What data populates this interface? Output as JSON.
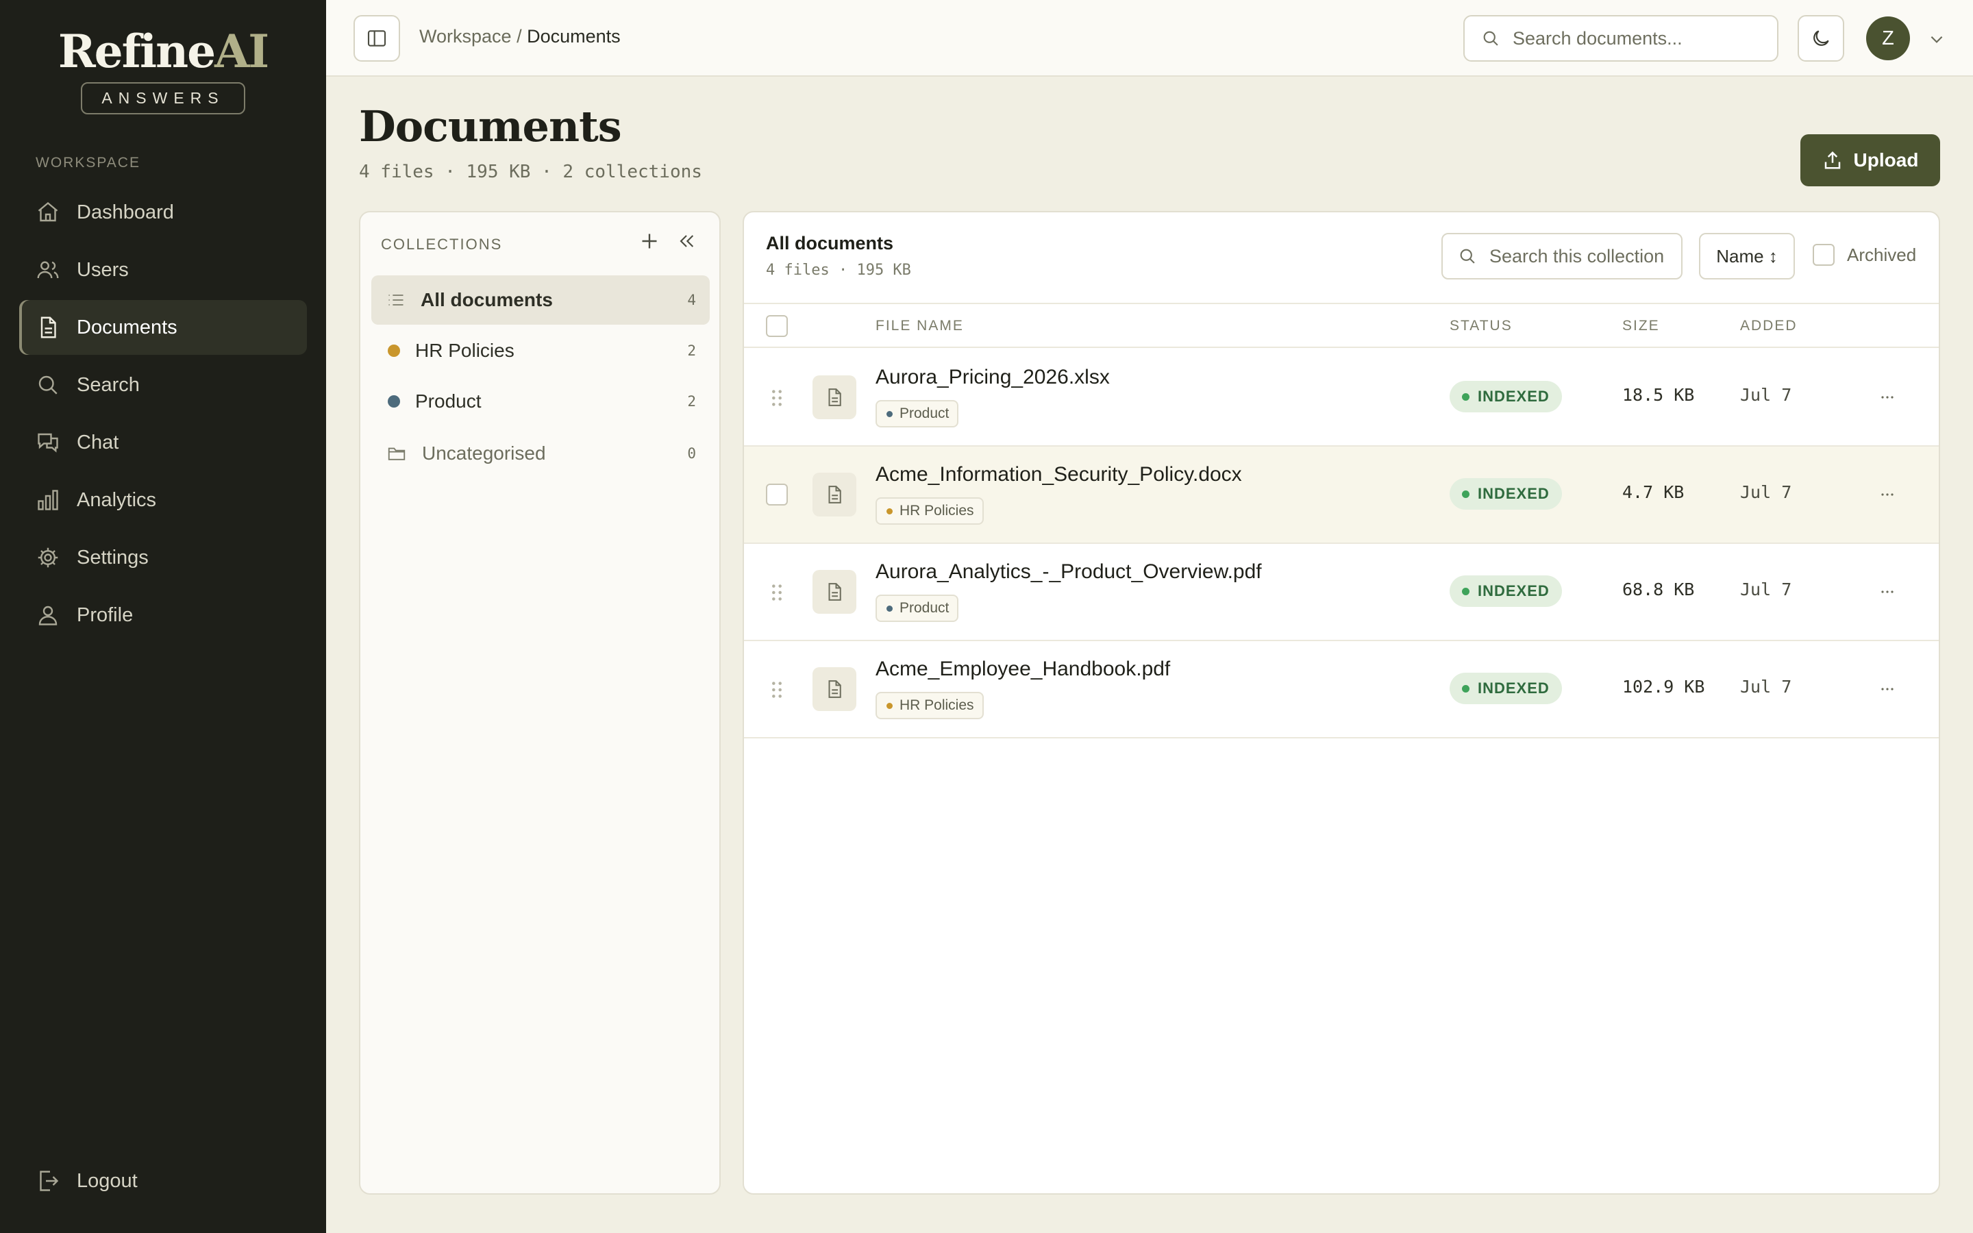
{
  "brand": {
    "name_main": "Refine",
    "name_accent": "AI",
    "tagline": "ANSWERS"
  },
  "sidebar": {
    "section_label": "WORKSPACE",
    "items": [
      {
        "label": "Dashboard",
        "icon": "home-icon"
      },
      {
        "label": "Users",
        "icon": "users-icon"
      },
      {
        "label": "Documents",
        "icon": "document-icon",
        "active": true
      },
      {
        "label": "Search",
        "icon": "search-icon"
      },
      {
        "label": "Chat",
        "icon": "chat-icon"
      },
      {
        "label": "Analytics",
        "icon": "bar-chart-icon"
      },
      {
        "label": "Settings",
        "icon": "gear-icon"
      },
      {
        "label": "Profile",
        "icon": "user-icon"
      }
    ],
    "logout_label": "Logout"
  },
  "topbar": {
    "breadcrumb_root": "Workspace",
    "breadcrumb_sep": "/",
    "breadcrumb_current": "Documents",
    "search_placeholder": "Search documents...",
    "avatar_initial": "Z"
  },
  "header": {
    "title": "Documents",
    "subtitle": "4 files · 195 KB · 2 collections",
    "upload_label": "Upload"
  },
  "collections": {
    "heading": "COLLECTIONS",
    "items": [
      {
        "label": "All documents",
        "count": "4"
      },
      {
        "label": "HR Policies",
        "count": "2",
        "color": "#c9962c"
      },
      {
        "label": "Product",
        "count": "2",
        "color": "#4d6b7c"
      },
      {
        "label": "Uncategorised",
        "count": "0"
      }
    ]
  },
  "main": {
    "title": "All documents",
    "subtitle": "4 files · 195 KB",
    "search_placeholder": "Search this collection",
    "sort_label": "Name ↕",
    "archived_label": "Archived",
    "columns": {
      "file_name": "FILE NAME",
      "status": "STATUS",
      "size": "SIZE",
      "added": "ADDED"
    },
    "rows": [
      {
        "name": "Aurora_Pricing_2026.xlsx",
        "tag": "Product",
        "status": "INDEXED",
        "size": "18.5 KB",
        "added": "Jul 7"
      },
      {
        "name": "Acme_Information_Security_Policy.docx",
        "tag": "HR Policies",
        "status": "INDEXED",
        "size": "4.7 KB",
        "added": "Jul 7"
      },
      {
        "name": "Aurora_Analytics_-_Product_Overview.pdf",
        "tag": "Product",
        "status": "INDEXED",
        "size": "68.8 KB",
        "added": "Jul 7"
      },
      {
        "name": "Acme_Employee_Handbook.pdf",
        "tag": "HR Policies",
        "status": "INDEXED",
        "size": "102.9 KB",
        "added": "Jul 7"
      }
    ]
  },
  "colors": {
    "sidebar_bg": "#1e1f19",
    "accent": "#4b5330",
    "page_bg": "#f1efe3",
    "status_green": "#3ea35a",
    "hr_tag": "#c9962c",
    "product_tag": "#4d6b7c"
  }
}
